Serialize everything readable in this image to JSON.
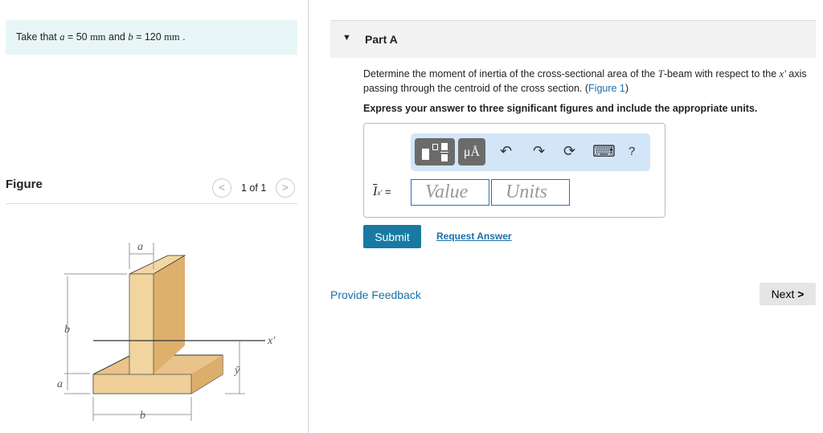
{
  "given": {
    "prefix": "Take that ",
    "a_var": "a",
    "eq1": " = 50 ",
    "unit1": "mm",
    "and": " and ",
    "b_var": "b",
    "eq2": " = 120 ",
    "unit2": "mm",
    "end": " ."
  },
  "figure": {
    "label": "Figure",
    "pager": "1 of 1",
    "labels": {
      "a_top": "a",
      "b_left": "b",
      "a_left": "a",
      "b_bottom": "b",
      "x_prime": "x′",
      "y_bar": "ȳ"
    }
  },
  "part": {
    "title": "Part A",
    "q1": "Determine the moment of inertia of the cross-sectional area of the ",
    "T": "T",
    "q2": "-beam with respect to the ",
    "xp": "x′",
    "q3": " axis passing through the centroid of the cross section. (",
    "fig_link": "Figure 1",
    "q4": ")",
    "instruction": "Express your answer to three significant figures and include the appropriate units."
  },
  "toolbar": {
    "templates": "templates-button",
    "units_sym": "μÅ",
    "undo": "↶",
    "redo": "↷",
    "reset": "⟳",
    "keyboard": "⌨",
    "help": "?"
  },
  "answer": {
    "label_I": "I",
    "label_sub": "x′",
    "eq": "=",
    "value_placeholder": "Value",
    "units_placeholder": "Units"
  },
  "buttons": {
    "submit": "Submit",
    "request": "Request Answer",
    "feedback": "Provide Feedback",
    "next": "Next"
  }
}
